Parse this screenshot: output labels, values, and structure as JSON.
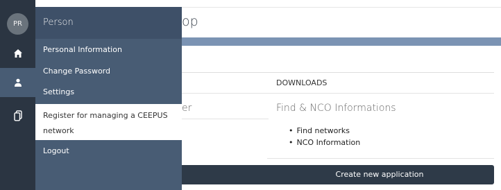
{
  "rail": {
    "avatar_initials": "PR",
    "items": [
      {
        "name": "home",
        "icon": "home-icon"
      },
      {
        "name": "person",
        "icon": "person-icon",
        "active": true
      },
      {
        "name": "documents",
        "icon": "documents-icon"
      }
    ]
  },
  "menu": {
    "title": "Person",
    "items": [
      {
        "label": "Personal Information"
      },
      {
        "label": "Change Password"
      },
      {
        "label": "Settings"
      },
      {
        "label": "Register for managing a CEEPUS network",
        "highlighted": true
      },
      {
        "label": "Logout"
      }
    ]
  },
  "page": {
    "title_fragment": "op",
    "downloads_header": "DOWNLOADS",
    "col1_fragment": "er",
    "downloads_title": "Find & NCO Informations",
    "downloads_links": [
      "Find networks",
      "NCO Information"
    ],
    "create_button": "Create new application"
  },
  "colors": {
    "rail_bg": "#2b3542",
    "menu_bg": "#485c74",
    "accent_band": "#7b93b3",
    "button_bg": "#2e3a48"
  }
}
